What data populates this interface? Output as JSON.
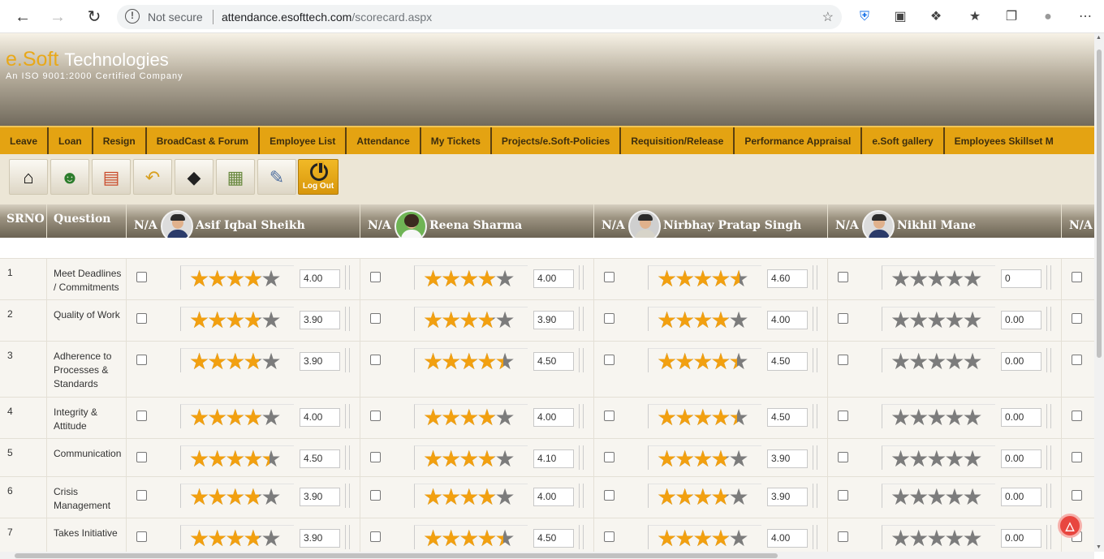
{
  "browser": {
    "security_label": "Not secure",
    "url_host": "attendance.esofttech.com",
    "url_path": "/scorecard.aspx"
  },
  "brand": {
    "name_accent": "e.Soft",
    "name_rest": "Technologies",
    "tagline": "An ISO 9001:2000 Certified Company"
  },
  "menu": [
    "Leave",
    "Loan",
    "Resign",
    "BroadCast & Forum",
    "Employee List",
    "Attendance",
    "My Tickets",
    "Projects/e.Soft-Policies",
    "Requisition/Release",
    "Performance Appraisal",
    "e.Soft gallery",
    "Employees Skillset M"
  ],
  "toolbar": {
    "icons": [
      "home-icon",
      "users-icon",
      "reports-icon",
      "undo-icon",
      "walking-sign-icon",
      "calendar-grid-icon",
      "form-edit-icon"
    ],
    "logout_label": "Log Out"
  },
  "table": {
    "headers": {
      "srno": "SRNO",
      "question": "Question",
      "na": "N/A"
    },
    "employees": [
      {
        "name": "Asif Iqbal Sheikh",
        "avatar": "male"
      },
      {
        "name": "Reena Sharma",
        "avatar": "female"
      },
      {
        "name": "Nirbhay Pratap Singh",
        "avatar": "photo"
      },
      {
        "name": "Nikhil Mane",
        "avatar": "male"
      }
    ],
    "rows": [
      {
        "srno": "1",
        "question": "Meet Deadlines / Commitments",
        "ratings": [
          "4.00",
          "4.00",
          "4.60",
          "0"
        ]
      },
      {
        "srno": "2",
        "question": "Quality of Work",
        "ratings": [
          "3.90",
          "3.90",
          "4.00",
          "0.00"
        ]
      },
      {
        "srno": "3",
        "question": "Adherence to Processes & Standards",
        "ratings": [
          "3.90",
          "4.50",
          "4.50",
          "0.00"
        ]
      },
      {
        "srno": "4",
        "question": "Integrity & Attitude",
        "ratings": [
          "4.00",
          "4.00",
          "4.50",
          "0.00"
        ]
      },
      {
        "srno": "5",
        "question": "Communication",
        "ratings": [
          "4.50",
          "4.10",
          "3.90",
          "0.00"
        ]
      },
      {
        "srno": "6",
        "question": "Crisis Management",
        "ratings": [
          "3.90",
          "4.00",
          "3.90",
          "0.00"
        ]
      },
      {
        "srno": "7",
        "question": "Takes Initiative",
        "ratings": [
          "3.90",
          "4.50",
          "4.00",
          "0.00"
        ]
      }
    ]
  },
  "colors": {
    "star_filled": "#f2a010",
    "star_empty": "#7c7c7c",
    "menu_bg": "#e4a312",
    "brand_accent": "#e8a81a"
  }
}
